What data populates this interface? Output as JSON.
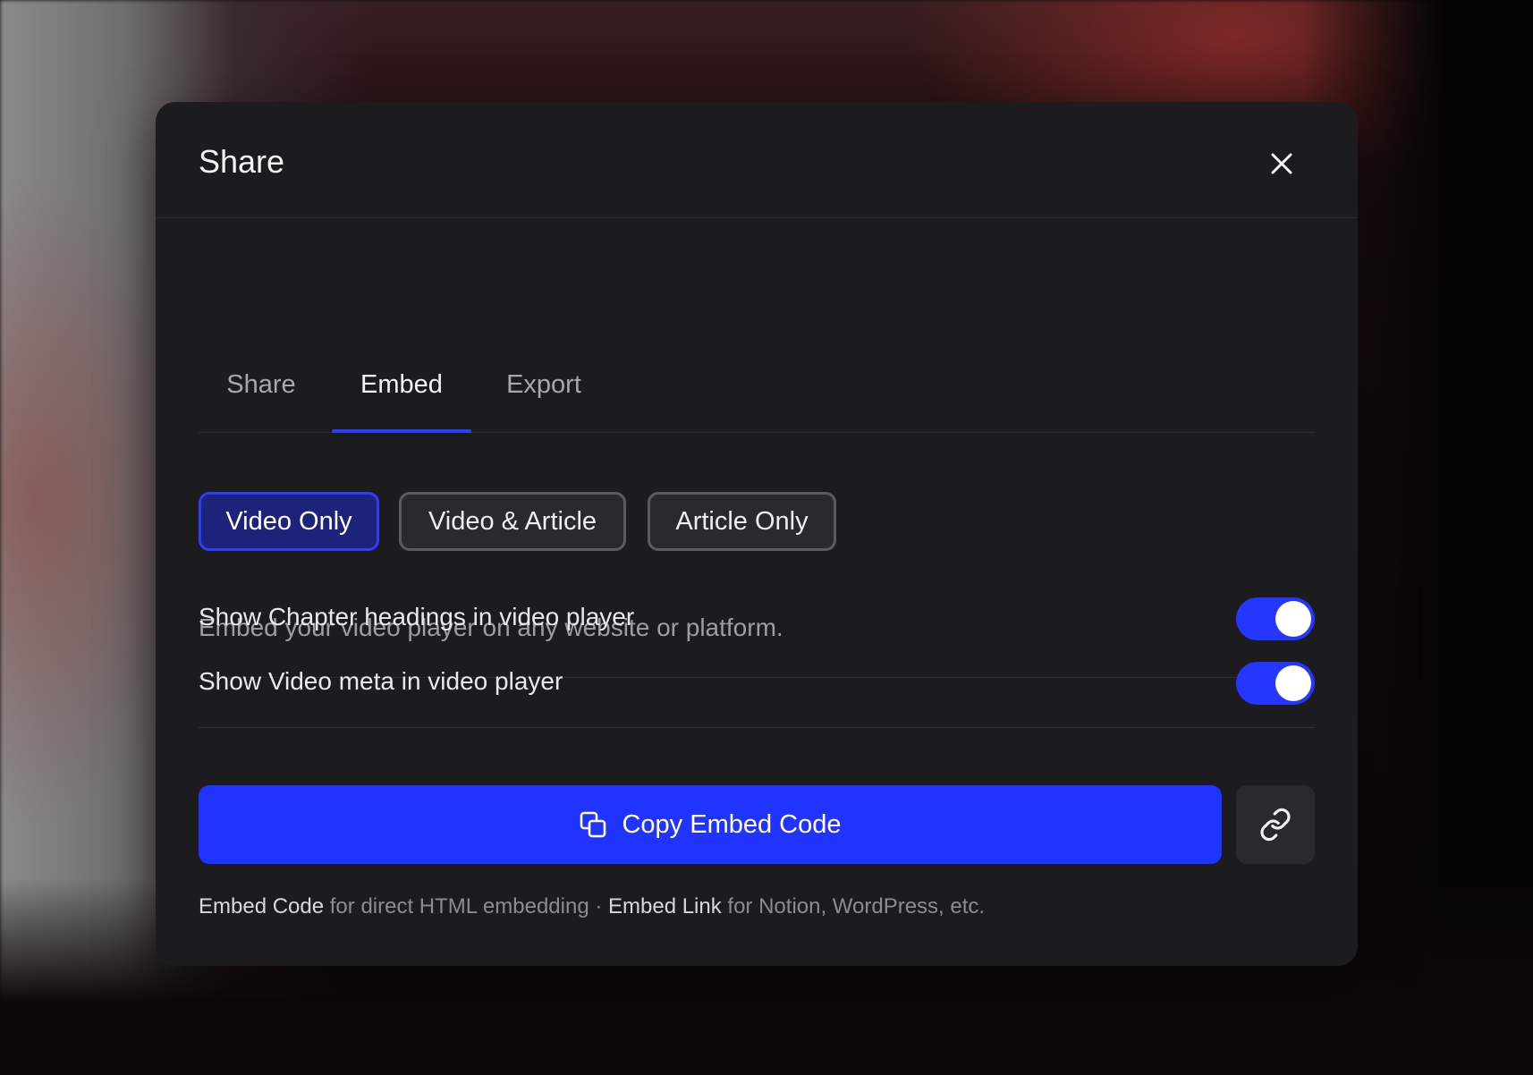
{
  "modal": {
    "title": "Share",
    "close_icon": "close-icon"
  },
  "tabs": [
    {
      "label": "Share",
      "active": false
    },
    {
      "label": "Embed",
      "active": true
    },
    {
      "label": "Export",
      "active": false
    }
  ],
  "embed_modes": [
    {
      "label": "Video Only",
      "selected": true
    },
    {
      "label": "Video & Article",
      "selected": false
    },
    {
      "label": "Article Only",
      "selected": false
    }
  ],
  "description": "Embed your video player on any website or platform.",
  "toggles": [
    {
      "label": "Show Chapter headings in video player",
      "on": true
    },
    {
      "label": "Show Video meta in video player",
      "on": true
    }
  ],
  "actions": {
    "copy_label": "Copy Embed Code",
    "copy_icon": "copy-icon",
    "link_icon": "link-icon"
  },
  "footer": {
    "embed_code": "Embed Code",
    "embed_code_desc": " for direct HTML embedding · ",
    "embed_link": "Embed Link",
    "embed_link_desc": " for Notion, WordPress, etc."
  },
  "colors": {
    "accent": "#2134ff",
    "modal_bg": "#1c1c1f",
    "selected_bg": "#1d237a"
  }
}
